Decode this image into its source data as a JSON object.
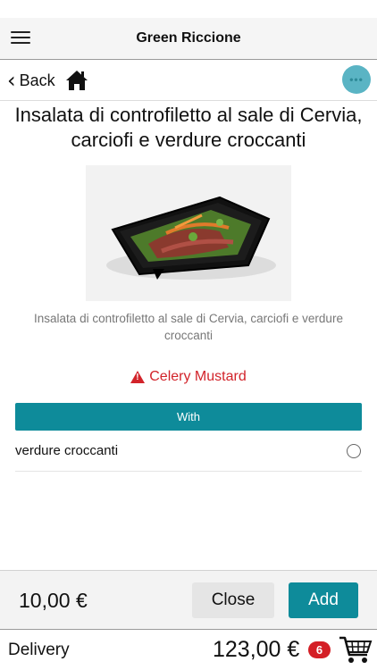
{
  "header": {
    "title": "Green Riccione"
  },
  "nav": {
    "back_label": "Back"
  },
  "product": {
    "title": "Insalata di controfiletto al sale di Cervia, carciofi e verdure croccanti",
    "description": "Insalata di controfiletto al sale di Cervia, carciofi e verdure croccanti",
    "allergens": "Celery Mustard"
  },
  "options": {
    "header": "With",
    "items": [
      {
        "label": "verdure croccanti",
        "selected": false
      }
    ]
  },
  "action_bar": {
    "price": "10,00 €",
    "close_label": "Close",
    "add_label": "Add"
  },
  "footer": {
    "delivery_label": "Delivery",
    "total": "123,00 €",
    "cart_count": "6"
  },
  "colors": {
    "accent": "#0e8b9a",
    "alert": "#d2232a",
    "badge": "#d41f26",
    "more_button": "#5ab4c4"
  }
}
